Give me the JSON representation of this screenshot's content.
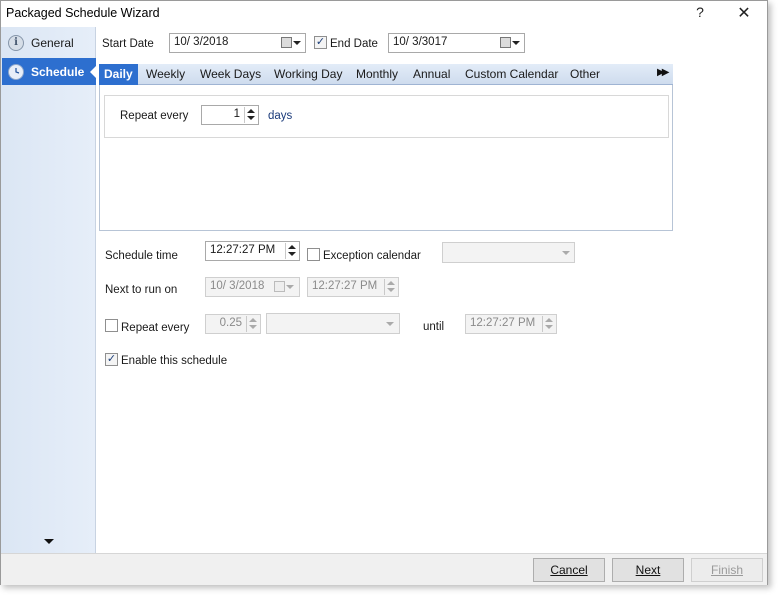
{
  "window": {
    "title": "Packaged Schedule Wizard",
    "help_label": "?",
    "close_label": "✕"
  },
  "sidebar": {
    "items": [
      {
        "label": "General",
        "icon": "info-icon",
        "selected": false
      },
      {
        "label": "Schedule",
        "icon": "clock-icon",
        "selected": true
      }
    ]
  },
  "dates": {
    "start_label": "Start Date",
    "start_value": "10/  3/2018",
    "end_checked": true,
    "end_label": "End Date",
    "end_value": "10/  3/3017"
  },
  "tabs": [
    {
      "label": "Daily",
      "active": true
    },
    {
      "label": "Weekly",
      "active": false
    },
    {
      "label": "Week Days",
      "active": false
    },
    {
      "label": "Working Day",
      "active": false
    },
    {
      "label": "Monthly",
      "active": false
    },
    {
      "label": "Annual",
      "active": false
    },
    {
      "label": "Custom Calendar",
      "active": false
    },
    {
      "label": "Other",
      "active": false
    }
  ],
  "tab_scroll_label": "▶▶",
  "daily": {
    "repeat_label": "Repeat every",
    "repeat_value": "1",
    "unit_label": "days"
  },
  "schedule_time": {
    "label": "Schedule time",
    "value": "12:27:27 PM",
    "exception_checked": false,
    "exception_label": "Exception calendar",
    "exception_value": ""
  },
  "next_run": {
    "label": "Next to run on",
    "date_value": "10/  3/2018",
    "time_value": "12:27:27 PM"
  },
  "repeat": {
    "checked": false,
    "label": "Repeat every",
    "interval_value": "0.25",
    "unit_value": "",
    "until_label": "until",
    "until_value": "12:27:27 PM"
  },
  "enable": {
    "checked": true,
    "label": "Enable this schedule"
  },
  "footer": {
    "cancel_label": "Cancel",
    "next_label": "Next",
    "finish_label": "Finish"
  },
  "colors": {
    "accent": "#2d6fcf",
    "sidebar_bg": "#dbe6f4",
    "tabstrip_bg": "#cfdcee"
  }
}
